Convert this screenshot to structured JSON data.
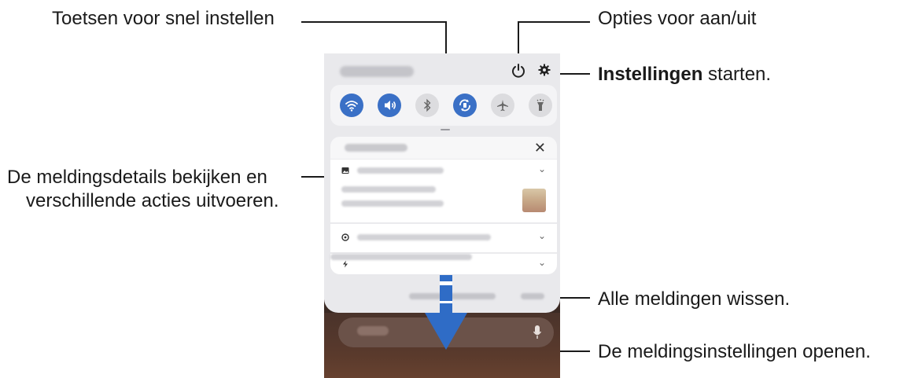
{
  "callouts": {
    "quick_settings": "Toetsen voor snel instellen",
    "power_options": "Opties voor aan/uit",
    "settings_bold": "Instellingen",
    "settings_rest": " starten.",
    "notif_details_line1": "De meldingsdetails bekijken en",
    "notif_details_line2": "verschillende acties uitvoeren.",
    "clear_all": "Alle meldingen wissen.",
    "notif_settings": "De meldingsinstellingen openen."
  },
  "quick_tiles": [
    {
      "name": "wifi",
      "state": "on"
    },
    {
      "name": "sound",
      "state": "on"
    },
    {
      "name": "bluetooth",
      "state": "off"
    },
    {
      "name": "auto-rotate",
      "state": "on"
    },
    {
      "name": "airplane-mode",
      "state": "off"
    },
    {
      "name": "flashlight",
      "state": "off"
    }
  ],
  "notification_panel": {
    "close_symbol": "✕",
    "chevron_symbol": "⌄"
  },
  "colors": {
    "tile_on": "#3a70c6",
    "tile_off": "#dcdcdf",
    "panel_bg": "#e9e9ec"
  }
}
